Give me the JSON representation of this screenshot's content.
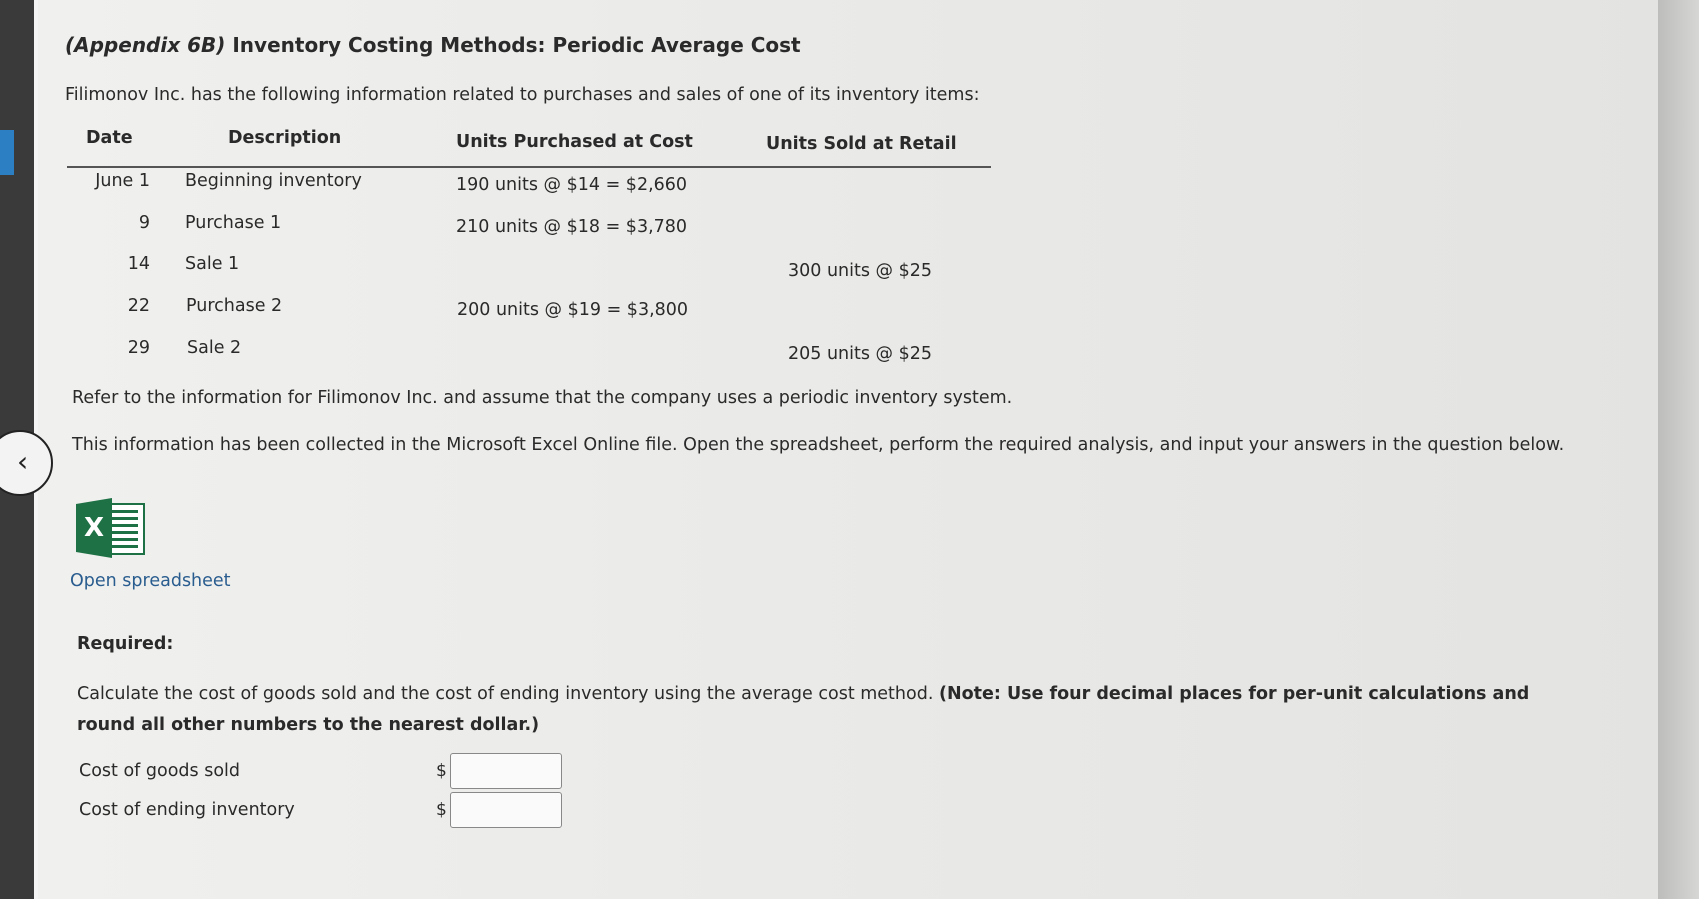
{
  "title_prefix": "(Appendix 6B)",
  "title": "Inventory Costing Methods: Periodic Average Cost",
  "intro": "Filimonov Inc. has the following information related to purchases and sales of one of its inventory items:",
  "table": {
    "headers": [
      "Date",
      "Description",
      "Units Purchased at Cost",
      "Units Sold at Retail"
    ],
    "rows": [
      {
        "date": "June 1",
        "description": "Beginning inventory",
        "purchased": "190 units @ $14 = $2,660",
        "sold": ""
      },
      {
        "date": "9",
        "description": "Purchase 1",
        "purchased": "210 units @ $18 = $3,780",
        "sold": ""
      },
      {
        "date": "14",
        "description": "Sale 1",
        "purchased": "",
        "sold": "300 units @ $25"
      },
      {
        "date": "22",
        "description": "Purchase 2",
        "purchased": "200 units @ $19 = $3,800",
        "sold": ""
      },
      {
        "date": "29",
        "description": "Sale 2",
        "purchased": "",
        "sold": "205 units @ $25"
      }
    ]
  },
  "refer_text": "Refer to the information for Filimonov Inc. and assume that the company uses a periodic inventory system.",
  "excel_text": "This information has been collected in the Microsoft Excel Online file. Open the spreadsheet, perform the required analysis, and input your answers in the question below.",
  "excel_icon_letter": "X",
  "open_spreadsheet": "Open spreadsheet",
  "required_label": "Required:",
  "instruction": "Calculate the cost of goods sold and the cost of ending inventory using the average cost method. ",
  "note": "(Note: Use four decimal places for per-unit calculations and",
  "note_line2": "round all other numbers to the nearest dollar.)",
  "fields": [
    {
      "label": "Cost of goods sold",
      "currency": "$",
      "value": ""
    },
    {
      "label": "Cost of ending inventory",
      "currency": "$",
      "value": ""
    }
  ],
  "colors": {
    "excel_green": "#1e7145",
    "link": "#2a5d8f"
  },
  "icons": {
    "back": "chevron-left-icon",
    "excel": "excel-icon"
  }
}
